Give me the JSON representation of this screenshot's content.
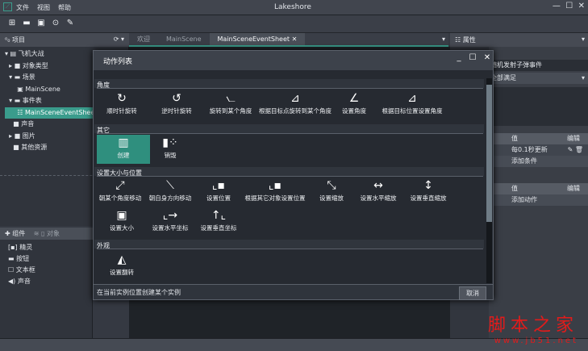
{
  "app": {
    "title": "Lakeshore",
    "menu": [
      "文件",
      "视图",
      "帮助"
    ]
  },
  "toolbar": {
    "icons": [
      "new-icon",
      "open-icon",
      "save-icon",
      "play-icon",
      "build-icon"
    ]
  },
  "project": {
    "header": "项目",
    "tree": [
      "飞机大战",
      "对象类型",
      "场景",
      "MainScene",
      "事件表",
      "MainSceneEventSheet",
      "声音",
      "图片",
      "其他资源"
    ]
  },
  "tabs": [
    "欢迎",
    "MainScene",
    "MainSceneEventSheet"
  ],
  "properties": {
    "header": "属性",
    "event_name": "随机发射子弹事件",
    "condition_mode": "全部满足",
    "col_value": "值",
    "col_edit": "编辑",
    "condition": "每0.1秒更新",
    "add_condition": "添加条件",
    "add_action": "添加动作"
  },
  "components": {
    "tab": "组件",
    "tab2": "对象",
    "items": [
      "精灵",
      "按钮",
      "文本框",
      "声音"
    ]
  },
  "dialog": {
    "title": "动作列表",
    "sections": {
      "angle": {
        "label": "角度",
        "items": [
          "顺时针旋转",
          "逆时针旋转",
          "旋转到某个角度",
          "根据目标点旋转到某个角度",
          "设置角度",
          "根据目标位置设置角度"
        ]
      },
      "other": {
        "label": "其它",
        "items": [
          "创建",
          "销毁"
        ]
      },
      "size": {
        "label": "设置大小与位置",
        "items": [
          "朝某个角度移动",
          "朝自身方向移动",
          "设置位置",
          "根据其它对象设置位置",
          "设置缩放",
          "设置水平缩放",
          "设置垂直缩放",
          "设置大小",
          "设置水平坐标",
          "设置垂直坐标"
        ]
      },
      "look": {
        "label": "外观",
        "items": [
          "设置翻转"
        ]
      }
    },
    "description": "在当前实例位置创建某个实例",
    "cancel": "取消"
  },
  "watermark": {
    "cn": "脚本之家",
    "url": "www.jb51.net"
  }
}
